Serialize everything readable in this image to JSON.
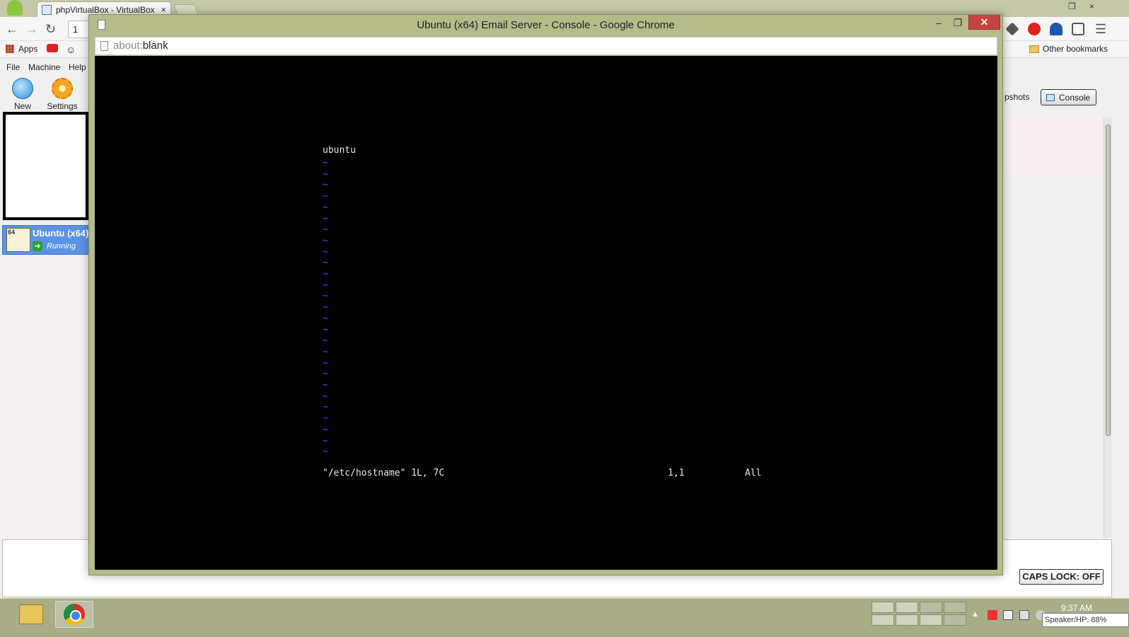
{
  "browser": {
    "tab_title": "phpVirtualBox - VirtualBox",
    "tab_close": "×",
    "window_controls": [
      "–",
      "❐",
      "×"
    ],
    "omnibox_value": "1",
    "bookmarks": {
      "apps": "Apps",
      "other": "Other bookmarks"
    }
  },
  "vbox": {
    "menu": [
      "File",
      "Machine",
      "Help"
    ],
    "toolbar": {
      "new_label": "New",
      "settings_label": "Settings"
    },
    "vm": {
      "badge": "64",
      "name": "Ubuntu (x64)",
      "state": "Running"
    },
    "right_tabs": {
      "snapshots_partial": "pshots",
      "console": "Console"
    },
    "caps_lock": "CAPS LOCK: OFF"
  },
  "popup": {
    "title": "Ubuntu (x64) Email Server - Console - Google Chrome",
    "controls": [
      "–",
      "❐",
      "✕"
    ],
    "address": {
      "scheme": "about:",
      "host": "blank"
    }
  },
  "console": {
    "first_line": "ubuntu",
    "tilde": "~",
    "tilde_count": 27,
    "status_file": "\"/etc/hostname\" 1L, 7C",
    "status_pos": "1,1",
    "status_scroll": "All"
  },
  "taskbar": {
    "time": "9:37 AM",
    "tooltip": "Speaker/HP: 88%"
  },
  "colors": {
    "tab_strip": "#c5c9a8",
    "popup_frame": "#b5bb8a",
    "close_button": "#c74343",
    "vm_selected": "#5b93e6",
    "vim_tilde": "#2b3fd6",
    "taskbar": "#a9ad88"
  }
}
